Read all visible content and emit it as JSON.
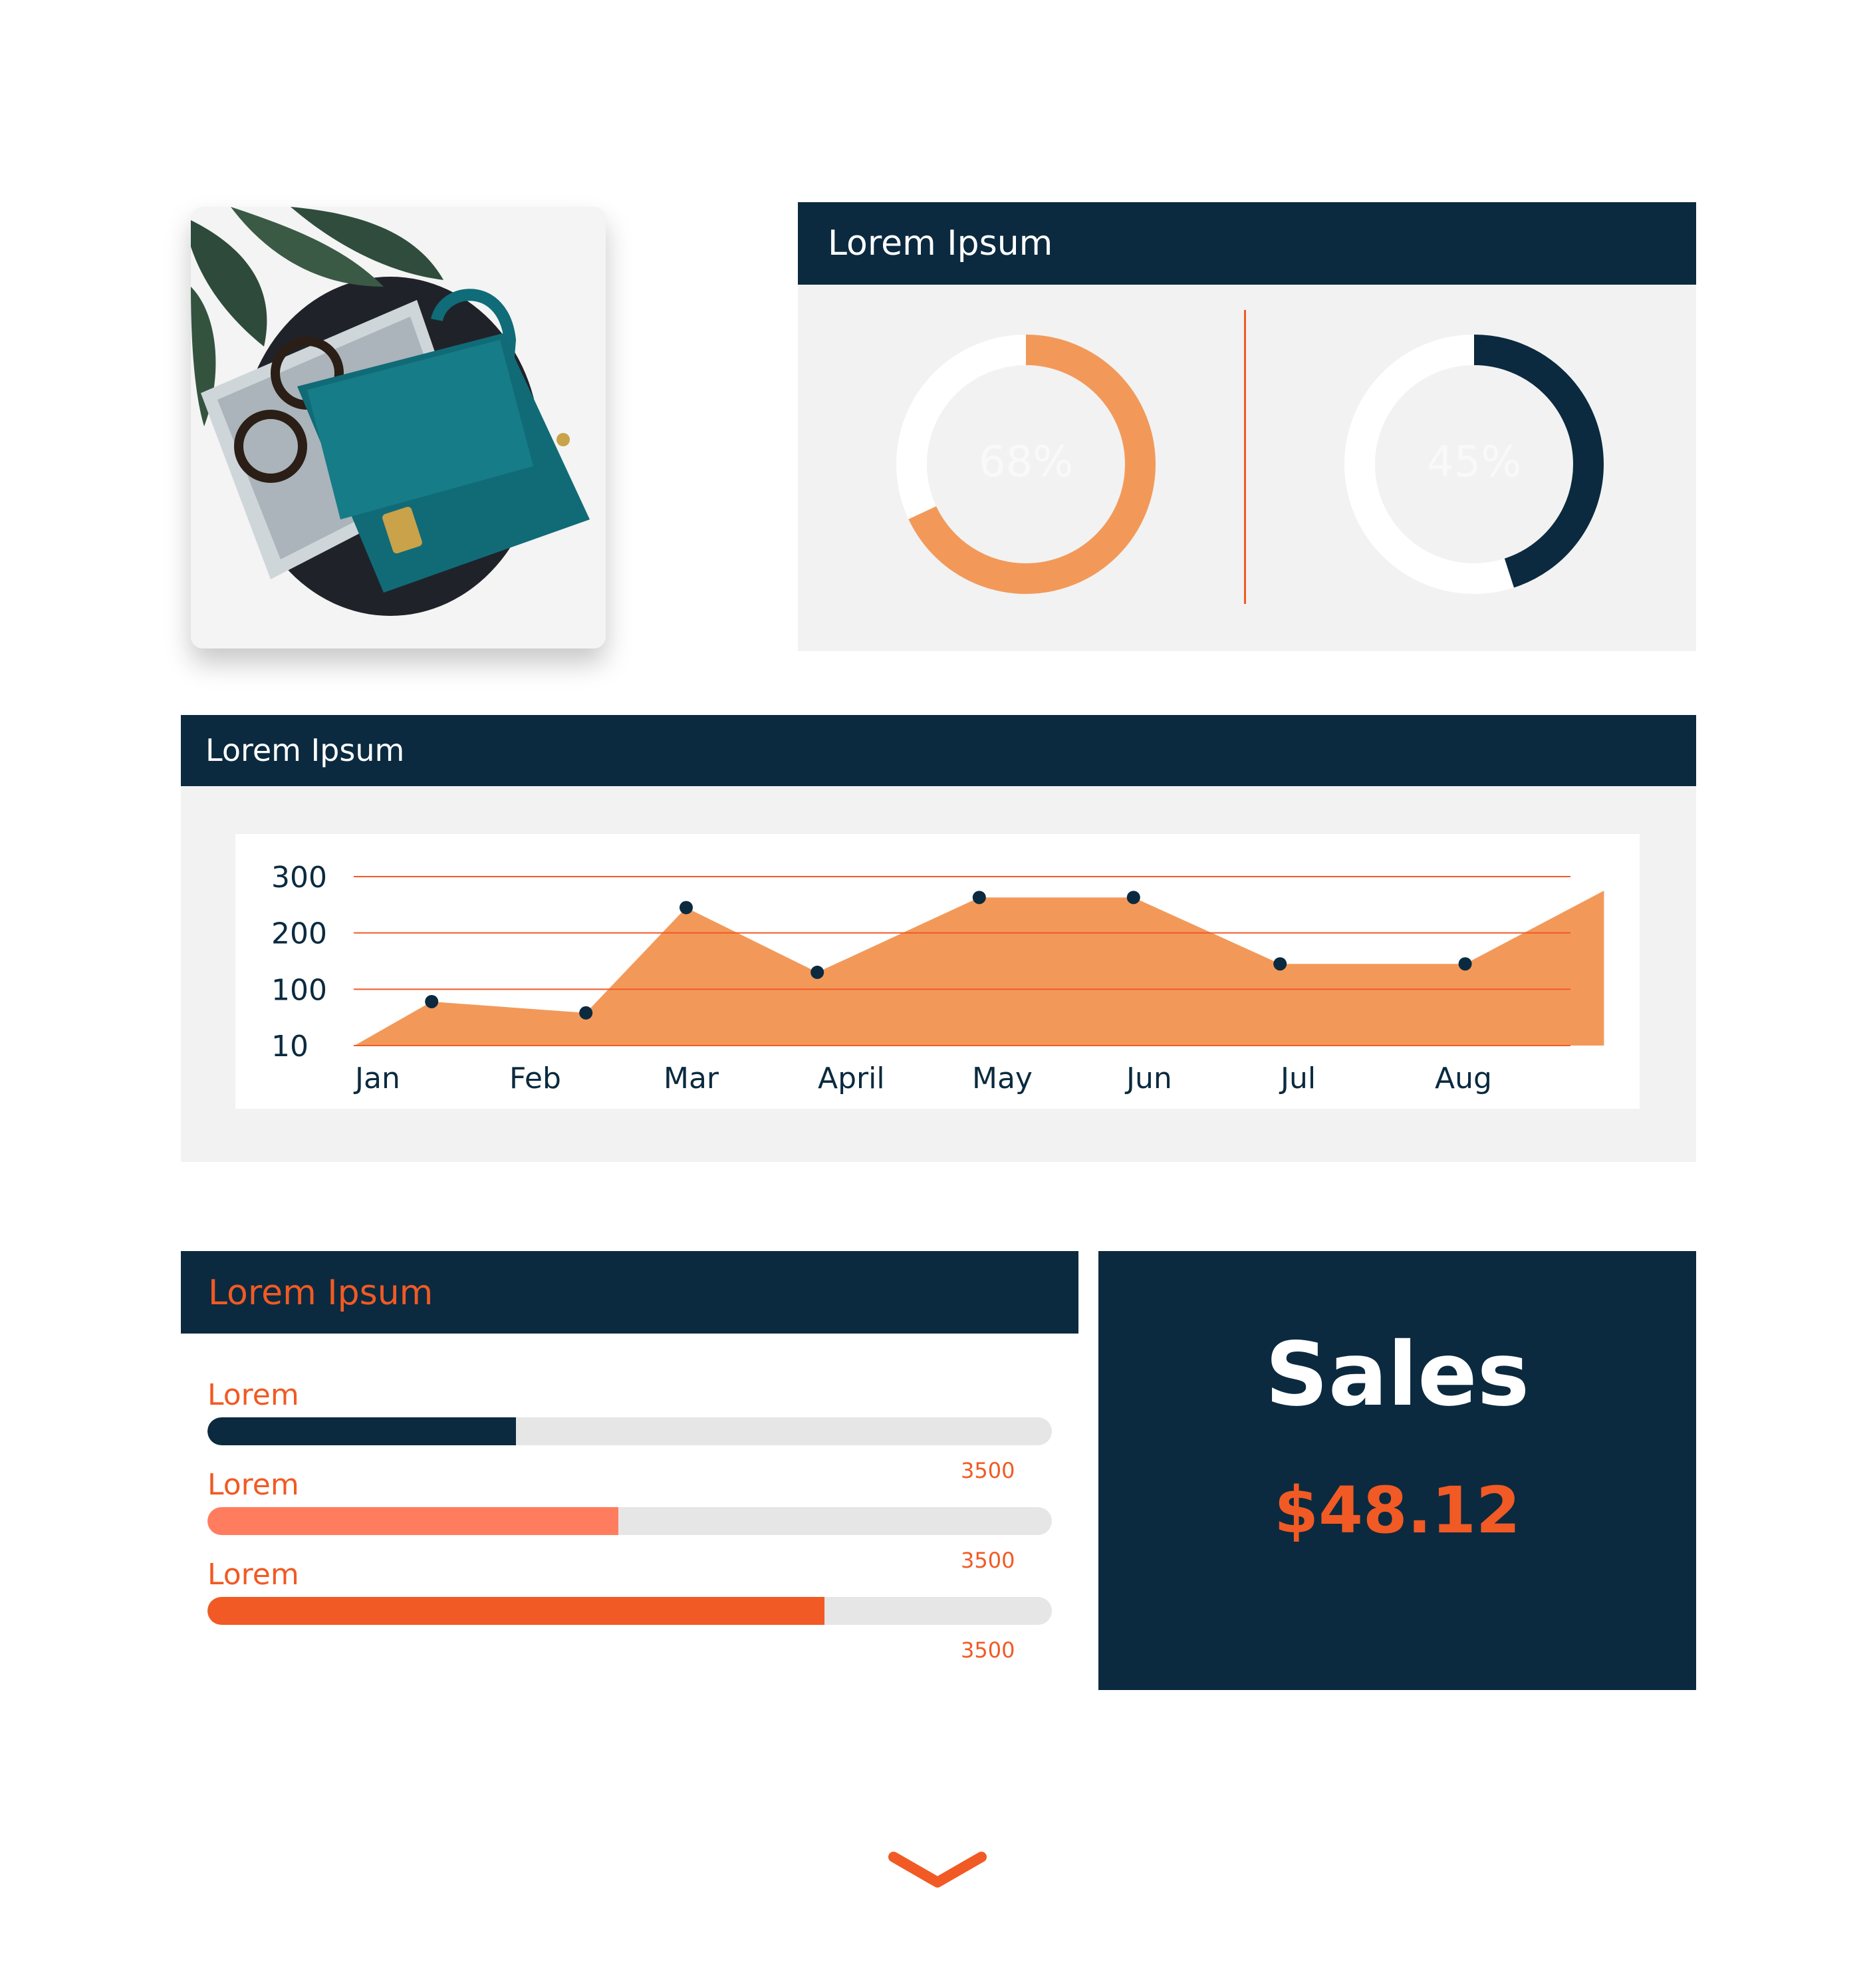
{
  "colors": {
    "navy": "#0b2a3f",
    "orange": "#f15a24",
    "light_orange": "#f2995a",
    "salmon": "#ff7d5e",
    "panel_gray": "#f2f2f2",
    "track_gray": "#e6e6e6"
  },
  "photo": {
    "icon": "handbag-photo"
  },
  "donut_panel": {
    "title": "Lorem Ipsum",
    "donuts": [
      {
        "label": "68%",
        "percent": 68,
        "color": "#f2995a"
      },
      {
        "label": "45%",
        "percent": 45,
        "color": "#0b2a3f"
      }
    ]
  },
  "area_panel": {
    "title": "Lorem Ipsum"
  },
  "chart_data": {
    "type": "area",
    "title": "",
    "xlabel": "",
    "ylabel": "",
    "categories": [
      "Jan",
      "Feb",
      "Mar",
      "April",
      "May",
      "Jun",
      "Jul",
      "Aug"
    ],
    "y_ticks": [
      {
        "label": "300",
        "value": 300
      },
      {
        "label": "200",
        "value": 200
      },
      {
        "label": "100",
        "value": 100
      },
      {
        "label": "10",
        "value": 0
      }
    ],
    "ylim": [
      0,
      300
    ],
    "series": [
      {
        "points": [
          {
            "x": 0.35,
            "y": 78
          },
          {
            "x": 1.35,
            "y": 58
          },
          {
            "x": 2.0,
            "y": 245
          },
          {
            "x": 2.85,
            "y": 130
          },
          {
            "x": 3.9,
            "y": 263
          },
          {
            "x": 4.9,
            "y": 263
          },
          {
            "x": 5.85,
            "y": 145
          },
          {
            "x": 7.05,
            "y": 145
          }
        ],
        "start": {
          "x": -0.15,
          "y": 0
        },
        "end": {
          "x": 7.95,
          "y": 275
        }
      }
    ],
    "grid": true
  },
  "bars_panel": {
    "title": "Lorem Ipsum",
    "items": [
      {
        "label": "Lorem",
        "value": "3500",
        "fraction": 0.365,
        "color": "#0b2a3f"
      },
      {
        "label": "Lorem",
        "value": "3500",
        "fraction": 0.487,
        "color": "#ff7d5e"
      },
      {
        "label": "Lorem",
        "value": "3500",
        "fraction": 0.731,
        "color": "#f15a24"
      }
    ]
  },
  "sales": {
    "title": "Sales",
    "value": "$48.12"
  },
  "nav": {
    "scroll_icon": "chevron-down-icon"
  }
}
